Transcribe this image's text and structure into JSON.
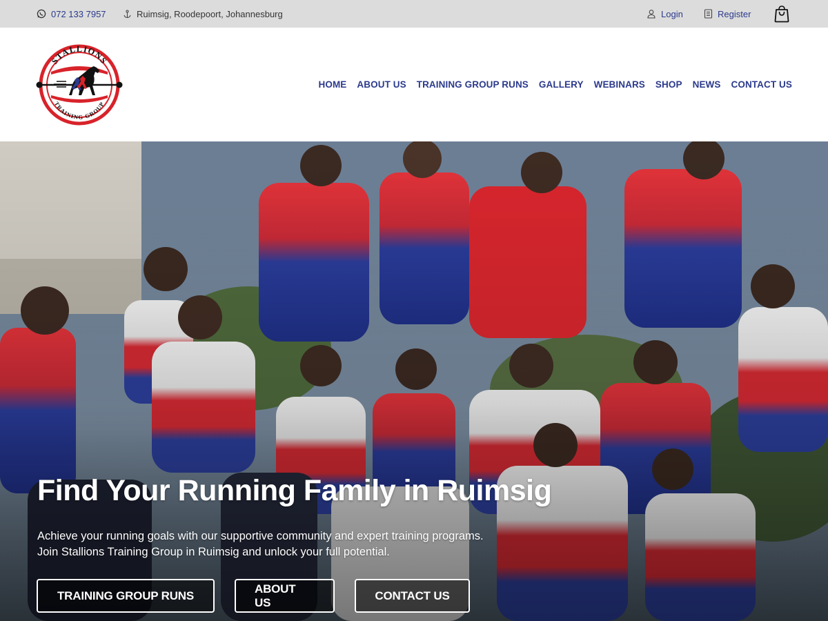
{
  "topbar": {
    "phone": "072 133 7957",
    "address": "Ruimsig, Roodepoort, Johannesburg",
    "login": "Login",
    "register": "Register",
    "icons": [
      "whatsapp-icon",
      "anchor-icon",
      "user-icon",
      "register-icon",
      "shopping-bag-icon"
    ]
  },
  "logo": {
    "top_text": "STALLIONS",
    "bottom_text": "TRAINING GROUP"
  },
  "nav": {
    "home": "HOME",
    "about": "ABOUT US",
    "training": "TRAINING GROUP RUNS",
    "gallery": "GALLERY",
    "webinars": "WEBINARS",
    "shop": "SHOP",
    "news": "NEWS",
    "contact": "CONTACT US"
  },
  "hero": {
    "title": "Find Your Running Family in Ruimsig",
    "subtitle_line1": "Achieve your running goals with our supportive community and expert training programs.",
    "subtitle_line2": "Join Stallions Training Group in Ruimsig and unlock your full potential.",
    "buttons": {
      "training": "TRAINING GROUP RUNS",
      "about": "ABOUT US",
      "contact": "CONTACT US"
    }
  },
  "colors": {
    "brand_blue": "#2b3a8c",
    "brand_red": "#d8232a",
    "topbar_bg": "#dcdcdc"
  }
}
